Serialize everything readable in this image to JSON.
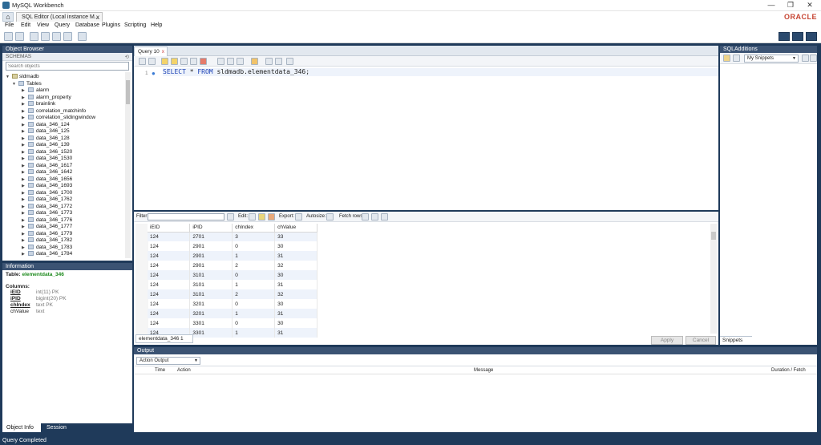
{
  "window": {
    "title": "MySQL Workbench",
    "controls": [
      "—",
      "❐",
      "✕"
    ]
  },
  "connection_tab": {
    "label": "SQL Editor (Local instance M...",
    "close": "x"
  },
  "brand": "ORACLE",
  "menu": [
    "File",
    "Edit",
    "View",
    "Query",
    "Database",
    "Plugins",
    "Scripting",
    "Help"
  ],
  "object_browser": {
    "header": "Object Browser",
    "schemas_label": "SCHEMAS",
    "search_placeholder": "Search objects",
    "schema": "sldmadb",
    "tables_label": "Tables",
    "tables": [
      "alarm",
      "alarm_property",
      "brainlink",
      "correlation_matchinfo",
      "correlation_slidingwindow",
      "data_346_124",
      "data_346_125",
      "data_346_128",
      "data_346_139",
      "data_346_1520",
      "data_346_1530",
      "data_346_1617",
      "data_346_1642",
      "data_346_1656",
      "data_346_1693",
      "data_346_1700",
      "data_346_1762",
      "data_346_1772",
      "data_346_1773",
      "data_346_1776",
      "data_346_1777",
      "data_346_1779",
      "data_346_1782",
      "data_346_1783",
      "data_346_1784"
    ]
  },
  "information": {
    "header": "Information",
    "table_label": "Table:",
    "table_name": "elementdata_346",
    "columns_label": "Columns:",
    "columns": [
      {
        "name": "iEID",
        "type": "int(11) PK"
      },
      {
        "name": "iPID",
        "type": "bigint(20) PK"
      },
      {
        "name": "chIndex",
        "type": "text PK"
      },
      {
        "name": "chValue",
        "type": "text"
      }
    ]
  },
  "bottom_tabs": [
    "Object Info",
    "Session"
  ],
  "query_tab": {
    "label": "Query 10",
    "close": "x"
  },
  "editor": {
    "line_number": "1",
    "code_keywords_1": "SELECT",
    "code_star": " * ",
    "code_keywords_2": "FROM",
    "code_rest": " sldmadb.elementdata_346;"
  },
  "results_toolbar": {
    "filter_label": "Filter",
    "edit_label": "Edit:",
    "export_label": "Export:",
    "autosize_label": "Autosize:",
    "fetch_label": "Fetch rows:"
  },
  "results": {
    "columns": [
      "iEID",
      "iPID",
      "chIndex",
      "chValue"
    ],
    "rows": [
      [
        "124",
        "2701",
        "3",
        "33"
      ],
      [
        "124",
        "2901",
        "0",
        "30"
      ],
      [
        "124",
        "2901",
        "1",
        "31"
      ],
      [
        "124",
        "2901",
        "2",
        "32"
      ],
      [
        "124",
        "3101",
        "0",
        "30"
      ],
      [
        "124",
        "3101",
        "1",
        "31"
      ],
      [
        "124",
        "3101",
        "2",
        "32"
      ],
      [
        "124",
        "3201",
        "0",
        "30"
      ],
      [
        "124",
        "3201",
        "1",
        "31"
      ],
      [
        "124",
        "3301",
        "0",
        "30"
      ],
      [
        "124",
        "3301",
        "1",
        "31"
      ]
    ],
    "result_tab": "elementdata_346 1"
  },
  "actions": {
    "apply": "Apply",
    "cancel": "Cancel"
  },
  "sql_additions": {
    "header": "SQLAdditions",
    "snippets_select": "My Snippets",
    "snippets_tab": "Snippets"
  },
  "output": {
    "header": "Output",
    "mode": "Action Output",
    "columns": [
      "Time",
      "Action",
      "Message",
      "Duration / Fetch"
    ]
  },
  "status": "Query Completed",
  "colors": {
    "panel_header": "#3b5373",
    "background": "#1f3a5a",
    "keyword": "#1a3fb5",
    "table_name": "#1e8a1e",
    "oracle": "#c74634"
  }
}
